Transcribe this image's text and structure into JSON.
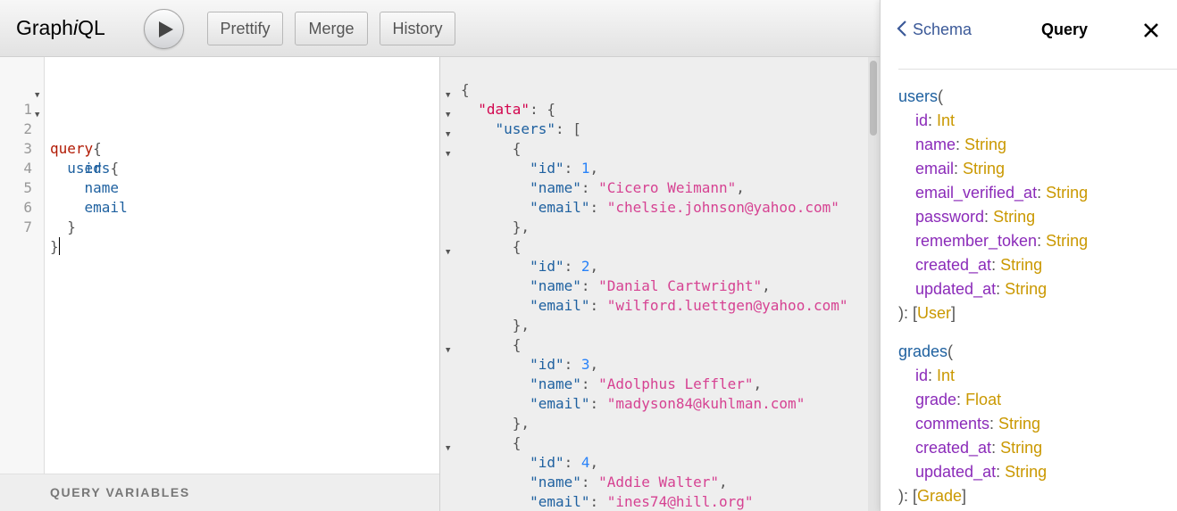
{
  "app": {
    "logo_prefix": "Graph",
    "logo_i": "i",
    "logo_suffix": "QL"
  },
  "toolbar": {
    "buttons": [
      {
        "label": "Prettify"
      },
      {
        "label": "Merge"
      },
      {
        "label": "History"
      }
    ]
  },
  "query_editor": {
    "lines": [
      {
        "n": "1",
        "t": "query{"
      },
      {
        "n": "2",
        "t": "  users{"
      },
      {
        "n": "3",
        "t": "    id"
      },
      {
        "n": "4",
        "t": "    name"
      },
      {
        "n": "5",
        "t": "    email"
      },
      {
        "n": "6",
        "t": "  }"
      },
      {
        "n": "7",
        "t": "}"
      }
    ],
    "variables_label": "QUERY VARIABLES"
  },
  "result": {
    "users": [
      {
        "id": 1,
        "name": "Cicero Weimann",
        "email": "chelsie.johnson@yahoo.com"
      },
      {
        "id": 2,
        "name": "Danial Cartwright",
        "email": "wilford.luettgen@yahoo.com"
      },
      {
        "id": 3,
        "name": "Adolphus Leffler",
        "email": "madyson84@kuhlman.com"
      },
      {
        "id": 4,
        "name": "Addie Walter",
        "email": "ines74@hill.org"
      }
    ]
  },
  "docs": {
    "back_label": "Schema",
    "title": "Query",
    "fields": [
      {
        "name": "users",
        "args": [
          {
            "name": "id",
            "type": "Int"
          },
          {
            "name": "name",
            "type": "String"
          },
          {
            "name": "email",
            "type": "String"
          },
          {
            "name": "email_verified_at",
            "type": "String"
          },
          {
            "name": "password",
            "type": "String"
          },
          {
            "name": "remember_token",
            "type": "String"
          },
          {
            "name": "created_at",
            "type": "String"
          },
          {
            "name": "updated_at",
            "type": "String"
          }
        ],
        "return_type": "User"
      },
      {
        "name": "grades",
        "args": [
          {
            "name": "id",
            "type": "Int"
          },
          {
            "name": "grade",
            "type": "Float"
          },
          {
            "name": "comments",
            "type": "String"
          },
          {
            "name": "created_at",
            "type": "String"
          },
          {
            "name": "updated_at",
            "type": "String"
          }
        ],
        "return_type": "Grade"
      }
    ]
  }
}
